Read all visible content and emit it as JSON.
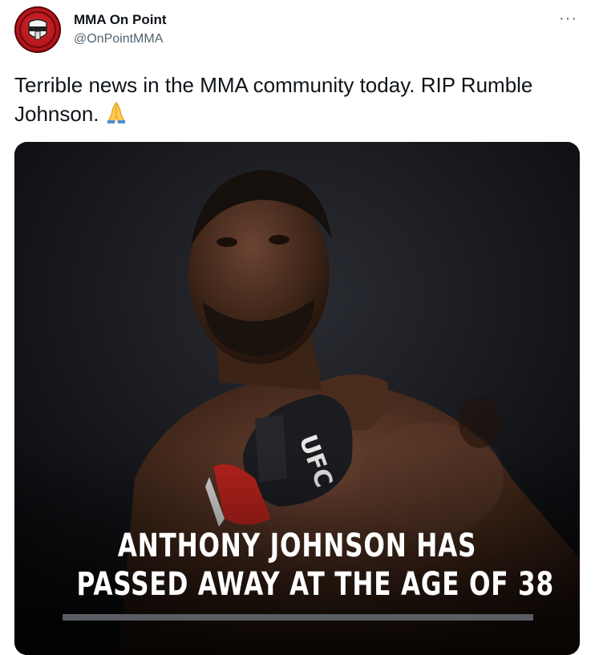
{
  "header": {
    "display_name": "MMA On Point",
    "handle": "@OnPointMMA",
    "more_label": "···",
    "avatar_icon": "mma-on-point-logo-icon"
  },
  "tweet": {
    "text": "Terrible news in the MMA community today. RIP Rumble Johnson.",
    "emoji_icon": "folded-hands-emoji-icon"
  },
  "media": {
    "caption_line1": "ANTHONY JOHNSON HAS",
    "caption_line2": "PASSED AWAY AT THE AGE OF 38",
    "glove_text": "UFC"
  },
  "colors": {
    "text_primary": "#0f1419",
    "text_secondary": "#536471",
    "avatar_red": "#c41e24"
  }
}
